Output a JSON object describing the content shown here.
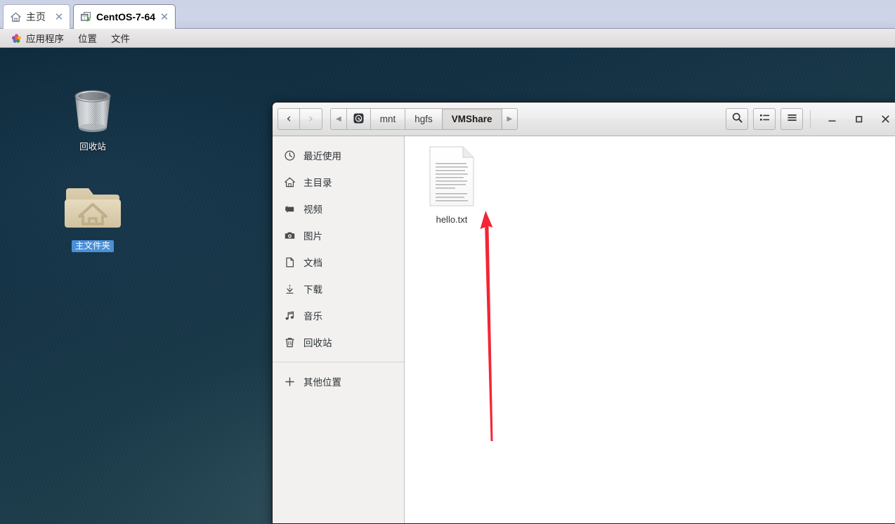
{
  "vmware": {
    "tabs": [
      {
        "label": "主页",
        "icon": "home-icon",
        "active": false,
        "close": "✕"
      },
      {
        "label": "CentOS-7-64",
        "icon": "virtual-machine-icon",
        "active": true,
        "close": "✕"
      }
    ]
  },
  "gnome_menubar": {
    "applications_icon": "gnome-foot-icon",
    "items": [
      "应用程序",
      "位置",
      "文件"
    ]
  },
  "desktop": {
    "icons": [
      {
        "name": "trash-icon",
        "label": "回收站",
        "selected": false
      },
      {
        "name": "home-folder-icon",
        "label": "主文件夹",
        "selected": true
      }
    ]
  },
  "files_window": {
    "nav": {
      "back": "‹",
      "forward": "›",
      "back_enabled": true,
      "forward_enabled": false
    },
    "pathbar": {
      "left_scroll": "◀",
      "right_scroll": "▶",
      "root_icon": "device-harddisk-icon",
      "crumbs": [
        {
          "label": "mnt",
          "current": false
        },
        {
          "label": "hgfs",
          "current": false
        },
        {
          "label": "VMShare",
          "current": true
        }
      ]
    },
    "toolbar": [
      {
        "name": "search-icon",
        "tooltip": "搜索"
      },
      {
        "name": "view-list-icon",
        "tooltip": "视图"
      },
      {
        "name": "hamburger-menu-icon",
        "tooltip": "菜单"
      }
    ],
    "window_controls": [
      {
        "name": "minimize-button",
        "glyph": "—"
      },
      {
        "name": "maximize-button",
        "glyph": "▫"
      },
      {
        "name": "close-button",
        "glyph": "✕"
      }
    ],
    "sidebar": {
      "items": [
        {
          "label": "最近使用",
          "icon": "clock-icon"
        },
        {
          "label": "主目录",
          "icon": "home-icon"
        },
        {
          "label": "视频",
          "icon": "video-icon"
        },
        {
          "label": "图片",
          "icon": "camera-icon"
        },
        {
          "label": "文档",
          "icon": "document-icon"
        },
        {
          "label": "下载",
          "icon": "download-icon"
        },
        {
          "label": "音乐",
          "icon": "music-icon"
        },
        {
          "label": "回收站",
          "icon": "trash-icon"
        }
      ],
      "other_locations": {
        "label": "其他位置",
        "icon": "plus-icon"
      }
    },
    "files": [
      {
        "name": "hello.txt",
        "icon": "text-document-icon"
      }
    ]
  },
  "annotation": {
    "arrow": {
      "name": "red-arrow-annotation",
      "color": "#f42534",
      "points_to": "hello.txt"
    }
  }
}
